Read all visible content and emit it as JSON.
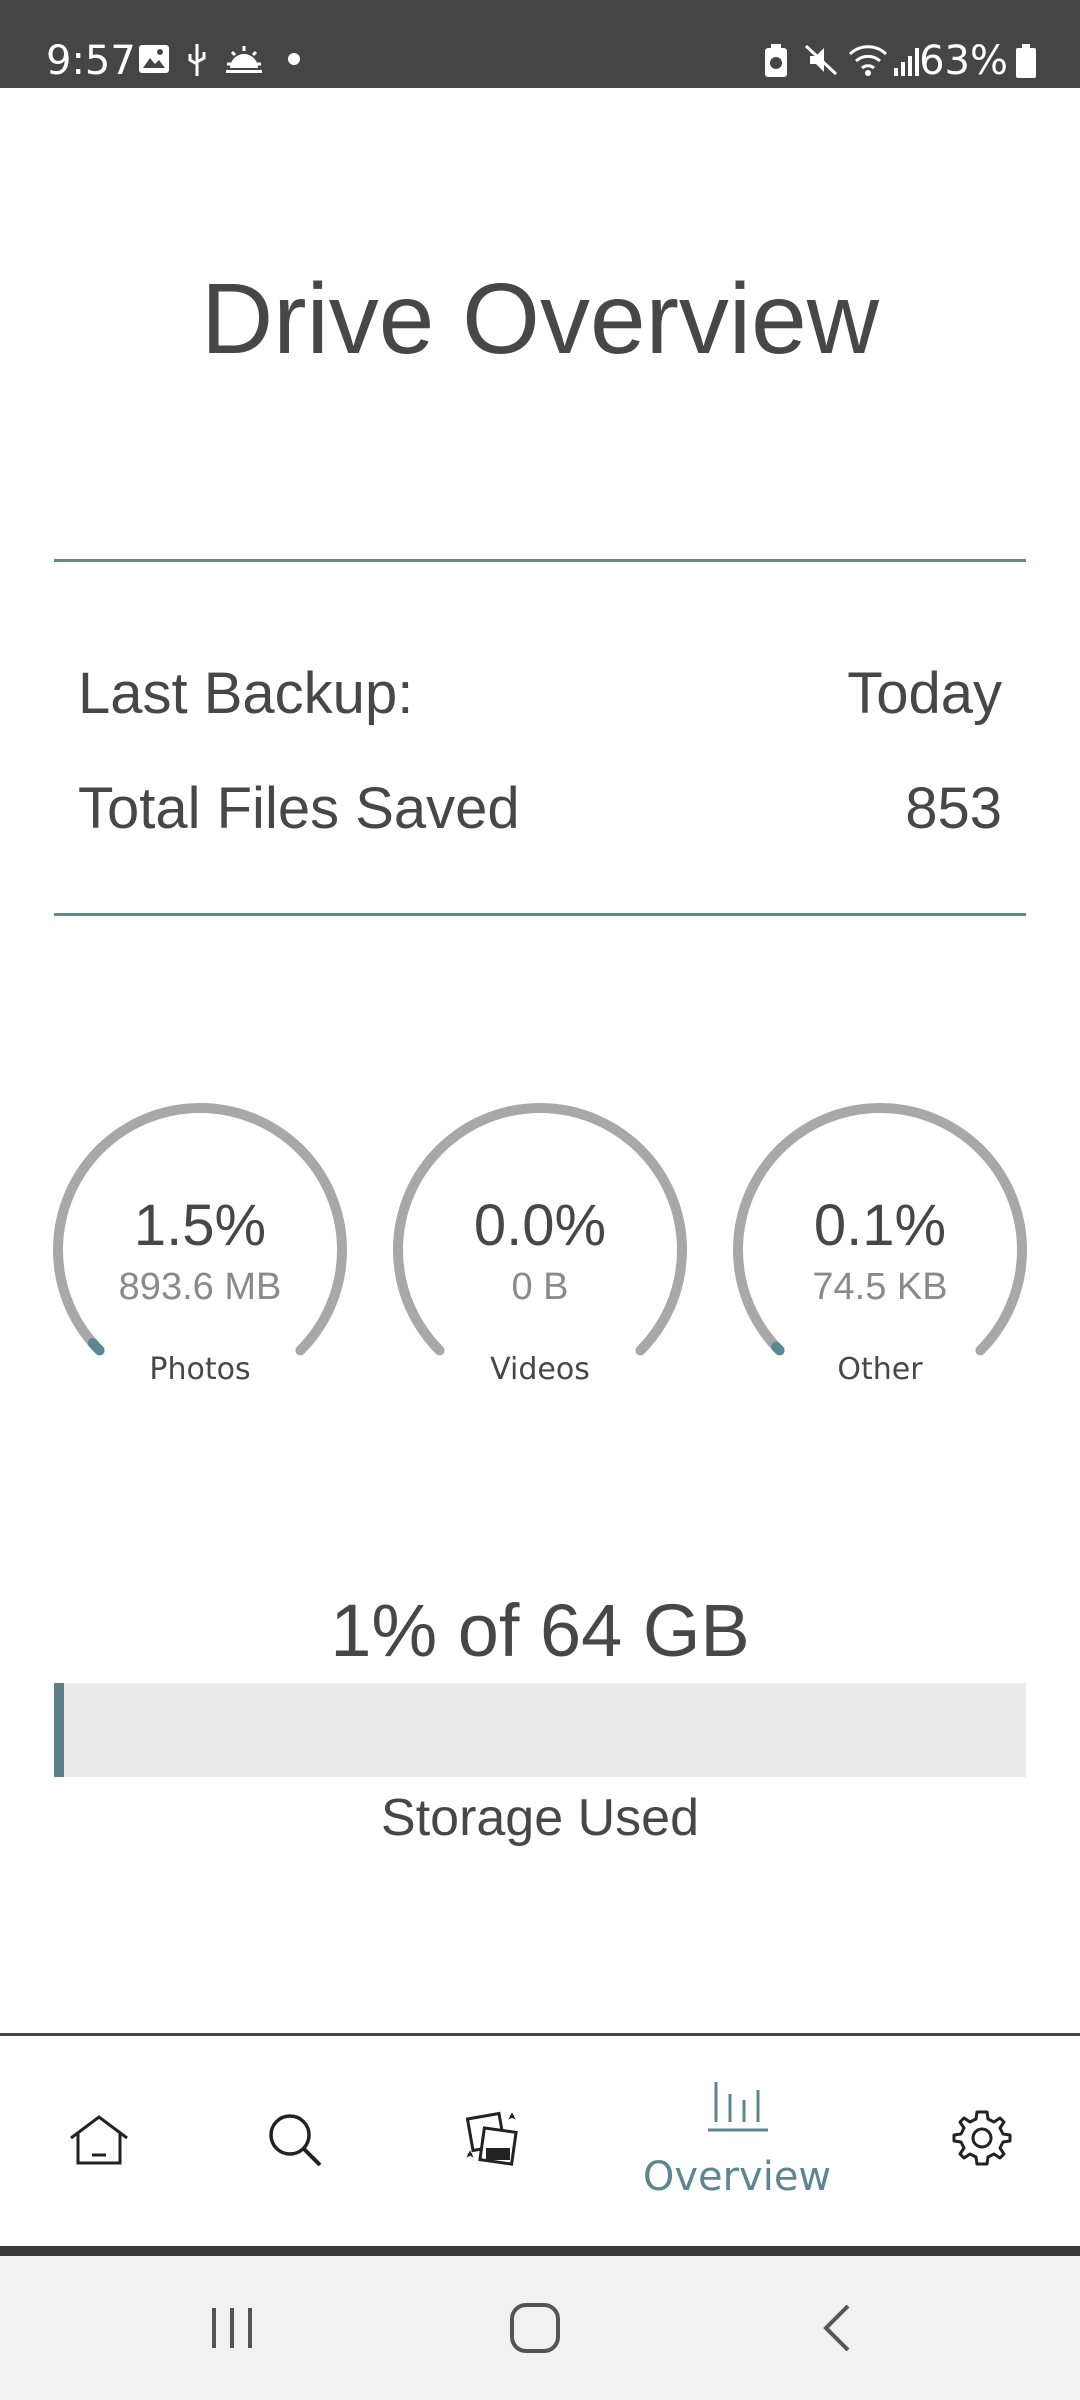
{
  "status_bar": {
    "time": "9:57",
    "battery": "63%",
    "icons": [
      "image-icon",
      "usb-icon",
      "weather-icon",
      "dot-icon",
      "battery-saver-icon",
      "mute-icon",
      "wifi-icon",
      "signal-icon",
      "battery-icon"
    ]
  },
  "title": "Drive Overview",
  "info": {
    "last_backup_label": "Last Backup:",
    "last_backup_value": "Today",
    "total_files_label": "Total Files Saved",
    "total_files_value": "853"
  },
  "gauges": [
    {
      "percent": "1.5%",
      "size": "893.6 MB",
      "label": "Photos",
      "fraction": 0.015
    },
    {
      "percent": "0.0%",
      "size": "0 B",
      "label": "Videos",
      "fraction": 0.0
    },
    {
      "percent": "0.1%",
      "size": "74.5 KB",
      "label": "Other",
      "fraction": 0.001
    }
  ],
  "storage": {
    "summary": "1% of 64 GB",
    "label": "Storage Used",
    "fraction": 0.01
  },
  "bottom_nav": {
    "items": [
      {
        "icon": "home-icon"
      },
      {
        "icon": "search-icon"
      },
      {
        "icon": "photos-icon"
      },
      {
        "icon": "bar-chart-icon",
        "label": "Overview",
        "active": true
      },
      {
        "icon": "gear-icon"
      }
    ]
  },
  "colors": {
    "accent": "#5b8791",
    "gauge_track": "#a8a8a8",
    "text": "#474747"
  }
}
